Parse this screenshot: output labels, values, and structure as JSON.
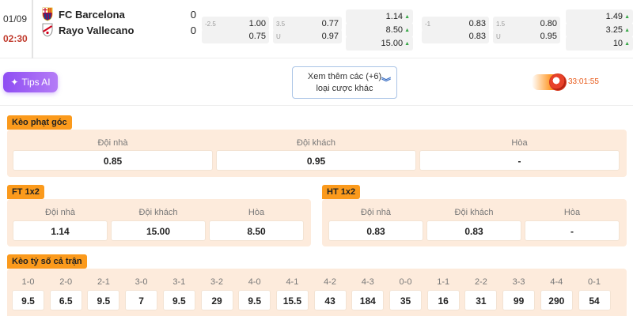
{
  "match": {
    "date": "01/09",
    "time": "02:30",
    "home": {
      "name": "FC Barcelona",
      "score": "0"
    },
    "away": {
      "name": "Rayo Vallecano",
      "score": "0"
    }
  },
  "odds": {
    "ft_handicap": [
      {
        "line": "-2.5",
        "value": "1.00"
      },
      {
        "line": "",
        "value": "0.75"
      }
    ],
    "ft_overunder": [
      {
        "line": "3.5",
        "value": "0.77"
      },
      {
        "line": "U",
        "value": "0.97"
      }
    ],
    "ft_1x2": [
      {
        "value": "1.14"
      },
      {
        "value": "8.50"
      },
      {
        "value": "15.00"
      }
    ],
    "ht_handicap": [
      {
        "line": "-1",
        "value": "0.83"
      },
      {
        "line": "",
        "value": "0.83"
      }
    ],
    "ht_overunder": [
      {
        "line": "1.5",
        "value": "0.80"
      },
      {
        "line": "U",
        "value": "0.95"
      }
    ],
    "ht_1x2": [
      {
        "value": "1.49"
      },
      {
        "value": "3.25"
      },
      {
        "value": "10"
      }
    ]
  },
  "tips_button": {
    "label": "Tips AI"
  },
  "more_markets": {
    "line1": "Xem thêm các (+6)",
    "line2": "loại cược khác"
  },
  "live_clock": {
    "time": "33:01:55"
  },
  "corner": {
    "title": "Kèo phạt góc",
    "headers": [
      "Đội nhà",
      "Đội khách",
      "Hòa"
    ],
    "values": [
      "0.85",
      "0.95",
      "-"
    ]
  },
  "ft1x2": {
    "title": "FT 1x2",
    "headers": [
      "Đội nhà",
      "Đội khách",
      "Hòa"
    ],
    "values": [
      "1.14",
      "15.00",
      "8.50"
    ]
  },
  "ht1x2": {
    "title": "HT 1x2",
    "headers": [
      "Đội nhà",
      "Đội khách",
      "Hòa"
    ],
    "values": [
      "0.83",
      "0.83",
      "-"
    ]
  },
  "correct_score": {
    "title": "Kèo tỷ số cả trận",
    "scores": [
      "1-0",
      "2-0",
      "2-1",
      "3-0",
      "3-1",
      "3-2",
      "4-0",
      "4-1",
      "4-2",
      "4-3",
      "0-0",
      "1-1",
      "2-2",
      "3-3",
      "4-4",
      "0-1"
    ],
    "values": [
      "9.5",
      "6.5",
      "9.5",
      "7",
      "9.5",
      "29",
      "9.5",
      "15.5",
      "43",
      "184",
      "35",
      "16",
      "31",
      "99",
      "290",
      "54"
    ]
  },
  "colors": {
    "accent_orange": "#fb9a1c",
    "panel_bg": "#fdebdc",
    "time_red": "#c0392b",
    "up_green": "#3aa84a",
    "tips_purple": "#8f4df3"
  }
}
